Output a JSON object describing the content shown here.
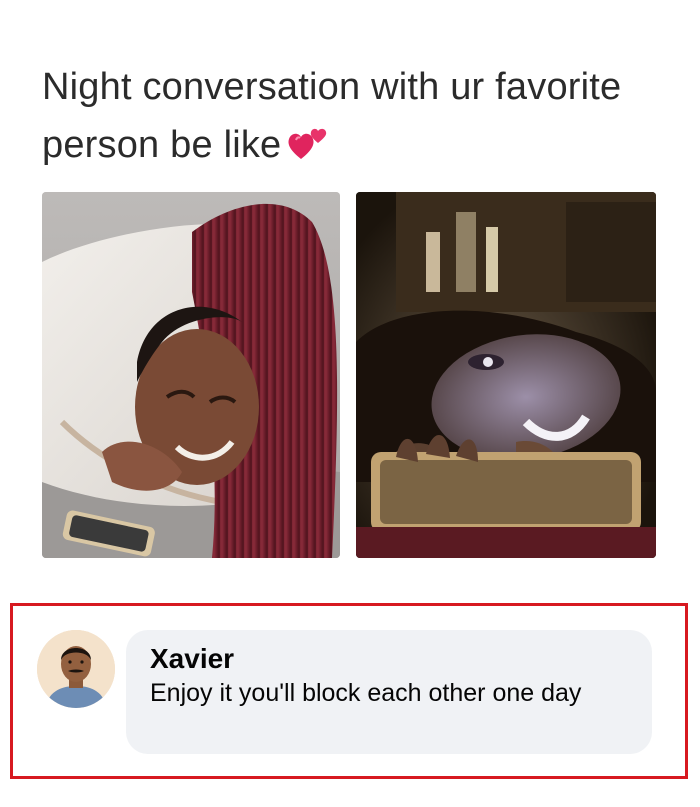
{
  "meme": {
    "caption_line1": "Night conversation with ur favorite",
    "caption_line2": "person be like",
    "caption_emoji": "two-hearts-emoji",
    "panels": [
      {
        "name": "man-in-bed-smiling-at-phone-photo"
      },
      {
        "name": "woman-lit-by-phone-screen-photo"
      }
    ]
  },
  "comment": {
    "author": "Xavier",
    "text": "Enjoy it you'll block each other one day",
    "highlight_color": "#d71920",
    "bubble_color": "#f0f2f5"
  },
  "icons": {
    "emoji": "two-hearts-emoji",
    "avatar": "user-avatar-photo"
  }
}
